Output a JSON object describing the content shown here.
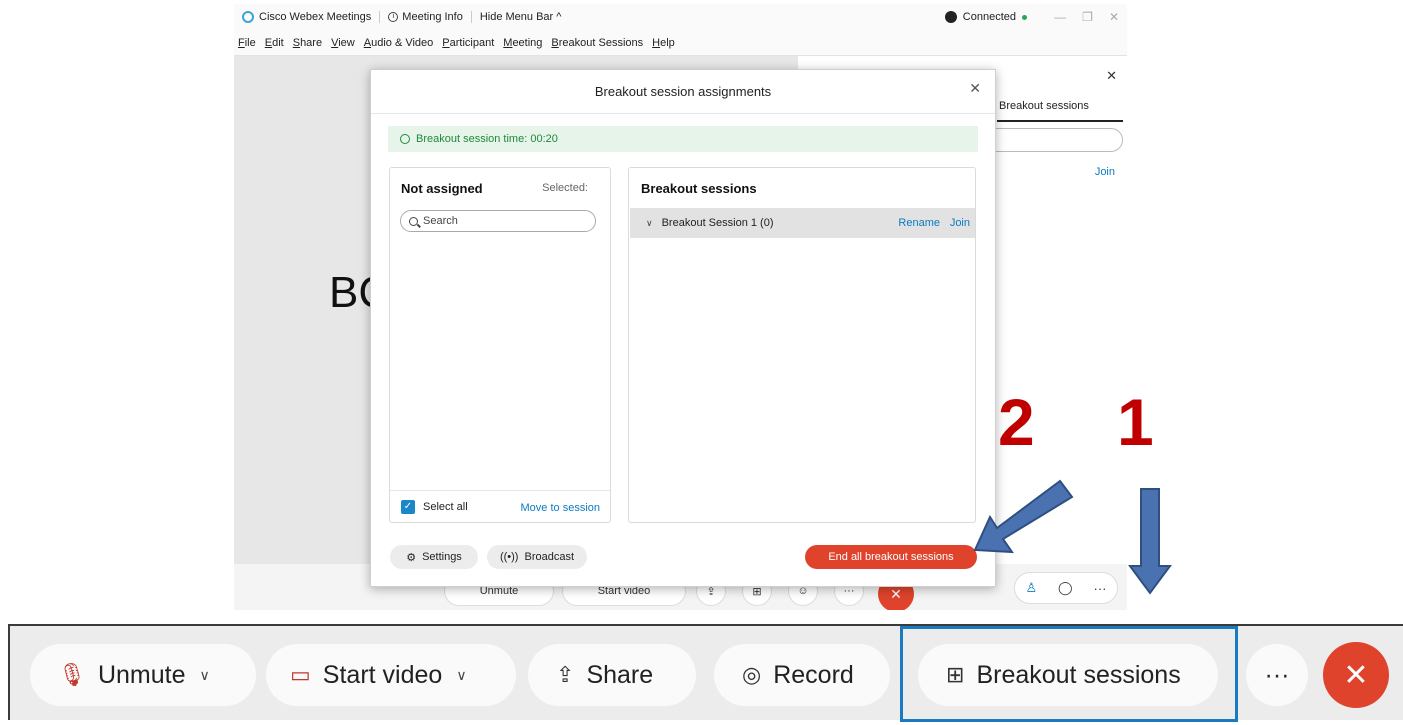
{
  "titlebar": {
    "app_name": "Cisco Webex Meetings",
    "meeting_info": "Meeting Info",
    "hide_menu": "Hide Menu Bar ^",
    "status": "Connected",
    "status_color": "#26a65b"
  },
  "menubar": {
    "items": [
      "File",
      "Edit",
      "Share",
      "View",
      "Audio & Video",
      "Participant",
      "Meeting",
      "Breakout Sessions",
      "Help"
    ]
  },
  "stage": {
    "text": "BC"
  },
  "side_panel": {
    "tab_label": "Breakout sessions",
    "join_label": "Join"
  },
  "mini_toolbar": {
    "unmute": "Unmute",
    "start_video": "Start video",
    "more": "···"
  },
  "dialog": {
    "title": "Breakout session assignments",
    "timer_text": "Breakout session time: 00:20",
    "not_assigned": {
      "title": "Not assigned",
      "selected_label": "Selected:",
      "search_placeholder": "Search",
      "select_all": "Select all",
      "move_to_session": "Move to session"
    },
    "breakout_sessions": {
      "title": "Breakout sessions",
      "sessions": [
        {
          "name": "Breakout Session 1 (0)",
          "rename": "Rename",
          "join": "Join"
        }
      ]
    },
    "settings_label": "Settings",
    "broadcast_label": "Broadcast",
    "end_all_label": "End all breakout sessions",
    "end_color": "#e0432b"
  },
  "annotations": {
    "number_1": "1",
    "number_2": "2",
    "number_color": "#c00000",
    "arrow_color": "#4a72b0"
  },
  "zoomed_toolbar": {
    "unmute": "Unmute",
    "start_video": "Start video",
    "share": "Share",
    "record": "Record",
    "breakout_sessions": "Breakout sessions",
    "more": "···",
    "highlight_color": "#1a7ac0"
  }
}
